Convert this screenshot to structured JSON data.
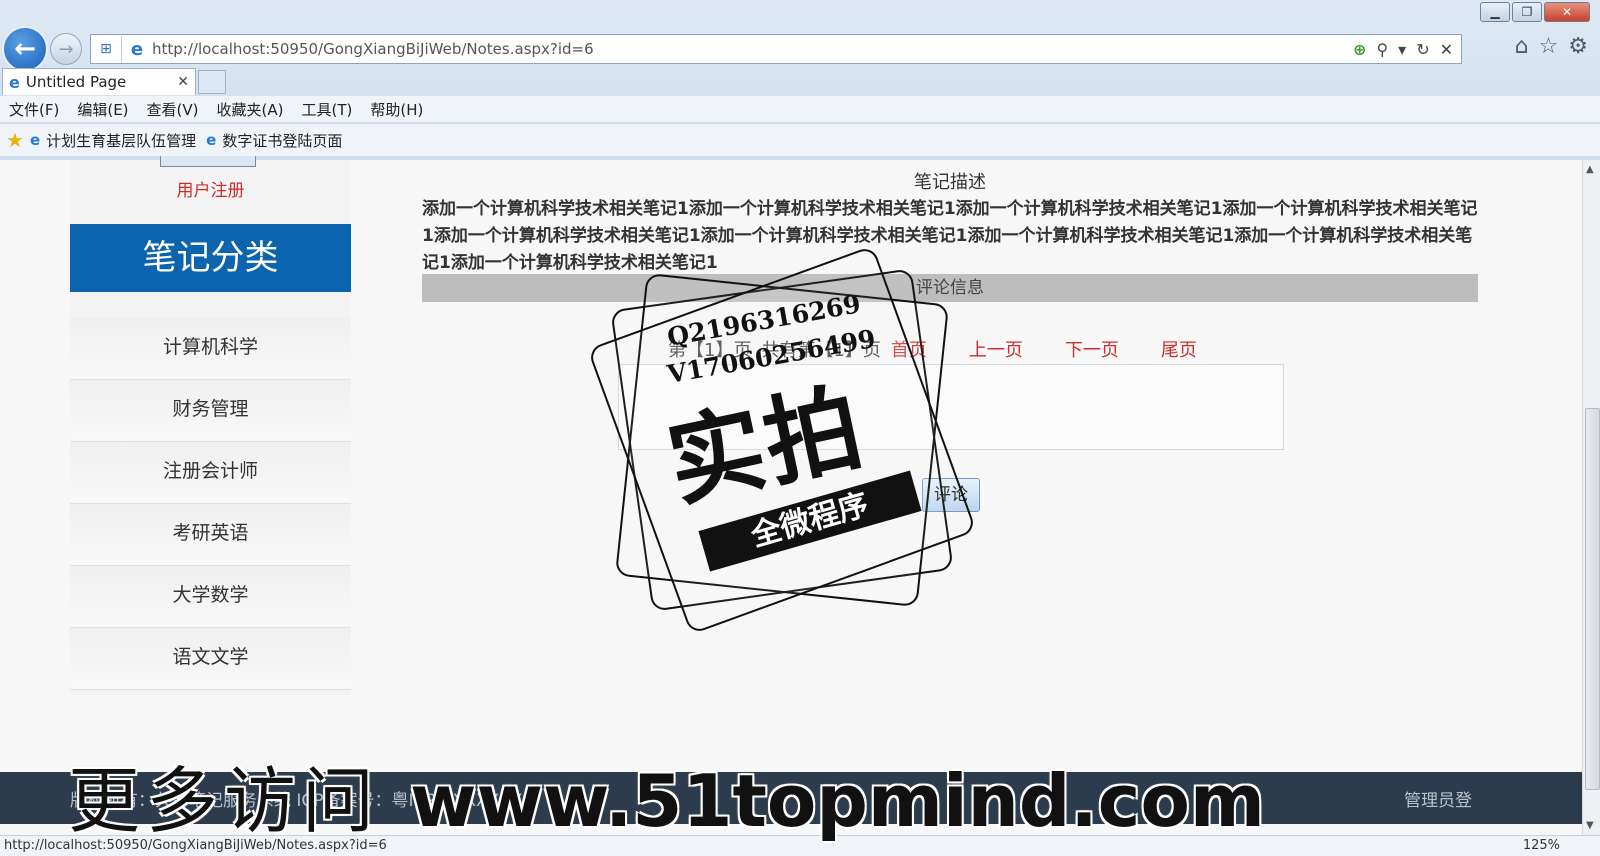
{
  "browser": {
    "address_url": "http://localhost:50950/GongXiangBiJiWeb/Notes.aspx?id=6",
    "tab_title": "Untitled Page",
    "menu": [
      "文件(F)",
      "编辑(E)",
      "查看(V)",
      "收藏夹(A)",
      "工具(T)",
      "帮助(H)"
    ],
    "favorites": [
      "计划生育基层队伍管理",
      "数字证书登陆页面"
    ],
    "status_url": "http://localhost:50950/GongXiangBiJiWeb/Notes.aspx?id=6",
    "zoom": "125%"
  },
  "sidebar": {
    "register_link": "用户注册",
    "category_title": "笔记分类",
    "categories": [
      "计算机科学",
      "财务管理",
      "注册会计师",
      "考研英语",
      "大学数学",
      "语文文学"
    ]
  },
  "main": {
    "desc_label": "笔记描述",
    "description": "添加一个计算机科学技术相关笔记1添加一个计算机科学技术相关笔记1添加一个计算机科学技术相关笔记1添加一个计算机科学技术相关笔记1添加一个计算机科学技术相关笔记1添加一个计算机科学技术相关笔记1添加一个计算机科学技术相关笔记1添加一个计算机科学技术相关笔记1添加一个计算机科学技术相关笔记1",
    "comment_header": "评论信息",
    "pager": {
      "current": "第【1】页",
      "total": "共有第【1】页",
      "first": "首页",
      "prev": "上一页",
      "next": "下一页",
      "last": "尾页"
    },
    "submit_label": "评论"
  },
  "footer": {
    "copyright": "版权所有：共享笔记服务系统 ICP备案号：粤ICP备XXXXXX",
    "right_text": "管理员登"
  },
  "watermark": {
    "qq": "Q2196316269",
    "v": "V17060256499",
    "big": "实拍",
    "band": "全微程序",
    "banner_cn": "更多访问",
    "banner_url": "www.51topmind.com"
  }
}
